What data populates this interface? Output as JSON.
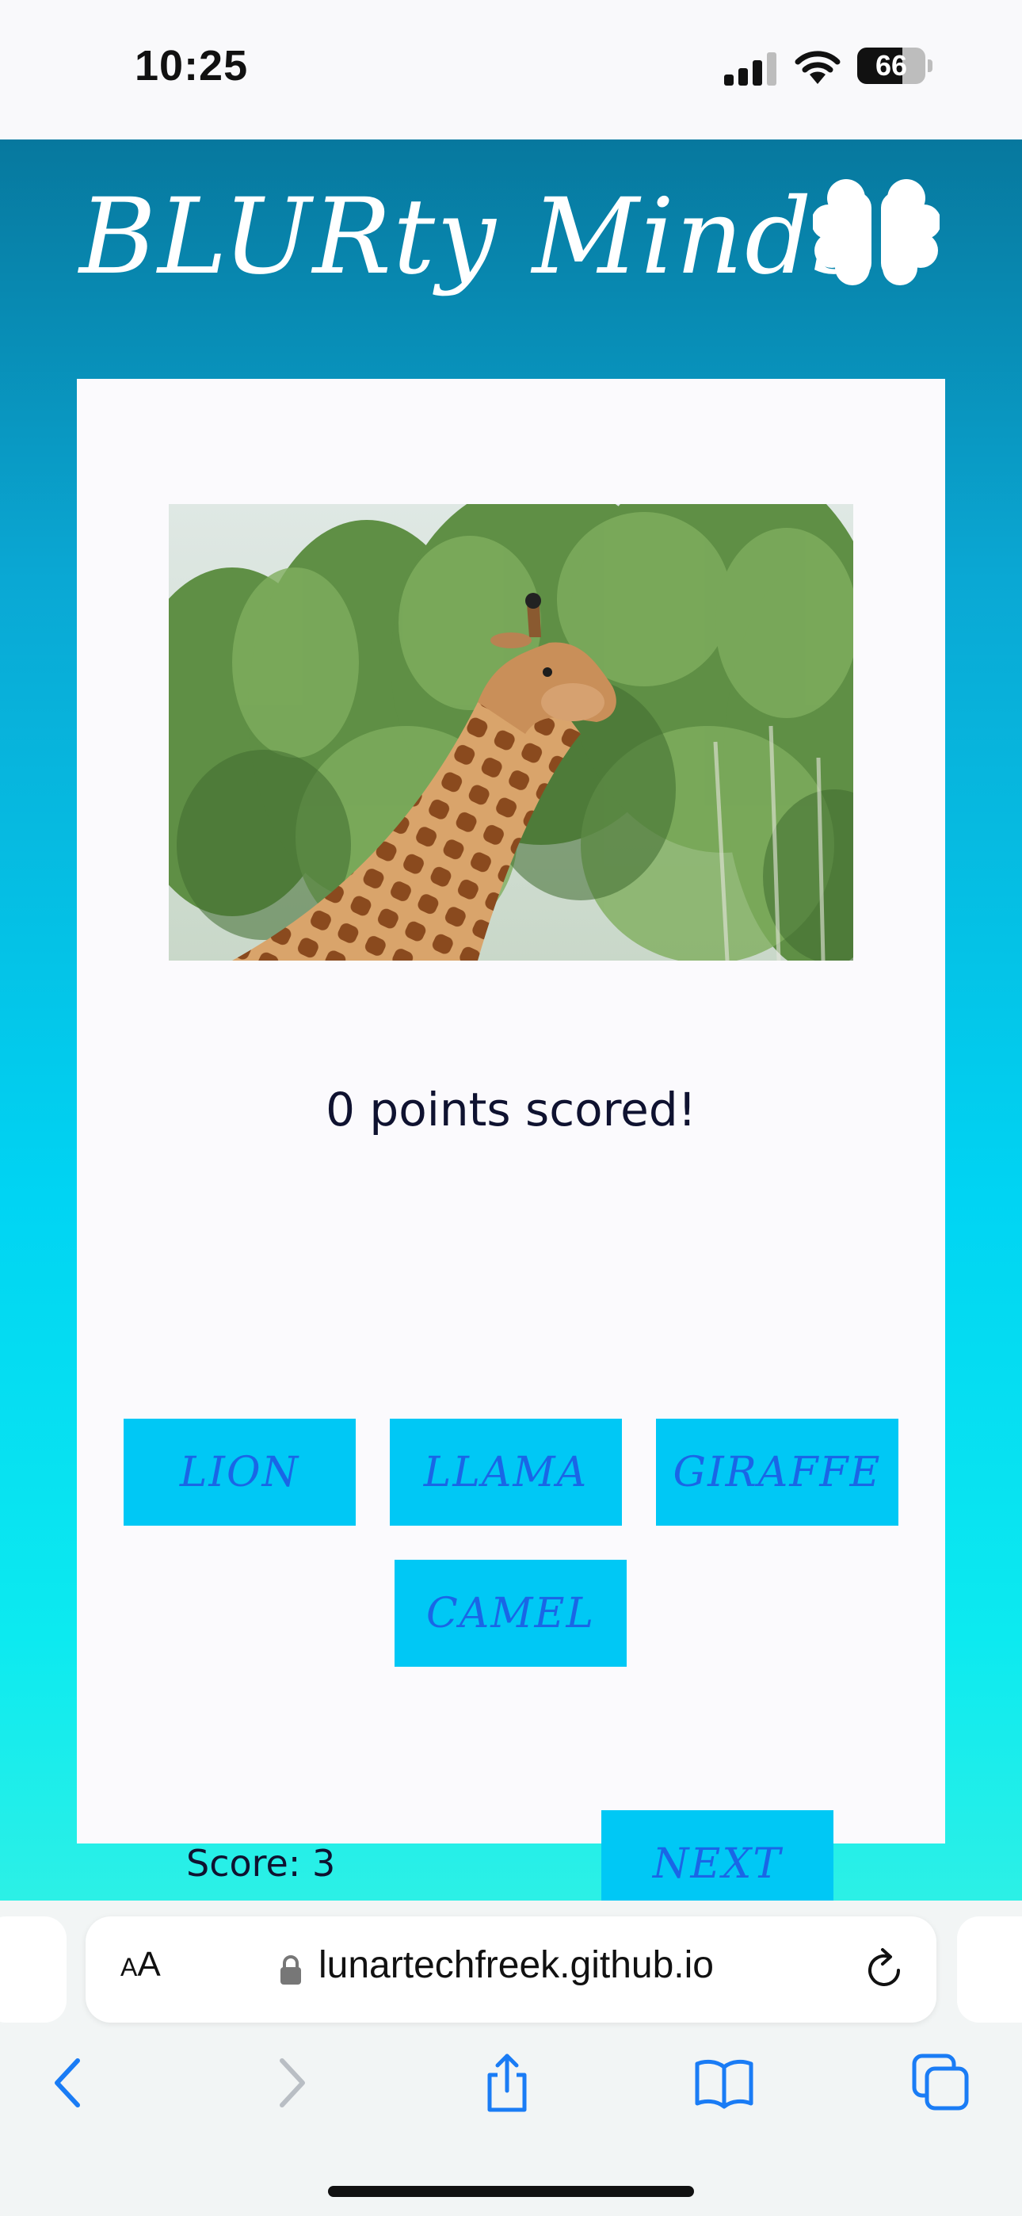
{
  "status_bar": {
    "time": "10:25",
    "battery_level": "66",
    "battery_fraction": 0.66,
    "icons": [
      "signal-icon",
      "wifi-icon",
      "battery-icon"
    ]
  },
  "app": {
    "title": "BLURty Minds",
    "logo_icon": "brain-icon",
    "image_subject": "giraffe photo",
    "score_message": "0 points scored!",
    "answers": [
      "LION",
      "LLAMA",
      "GIRAFFE",
      "CAMEL"
    ],
    "score_label": "Score: 3",
    "next_label": "NEXT",
    "colors": {
      "gradient_top": "#07789e",
      "gradient_bottom": "#2cf0e6",
      "button_bg": "#00c8f5",
      "button_text": "#1a66e6",
      "card_bg": "#fbfafd"
    }
  },
  "browser": {
    "text_size_button": "AA",
    "url": "lunartechfreek.github.io",
    "icons": [
      "lock-icon",
      "reload-icon",
      "back-icon",
      "forward-icon",
      "share-icon",
      "bookmarks-icon",
      "tabs-icon"
    ]
  }
}
